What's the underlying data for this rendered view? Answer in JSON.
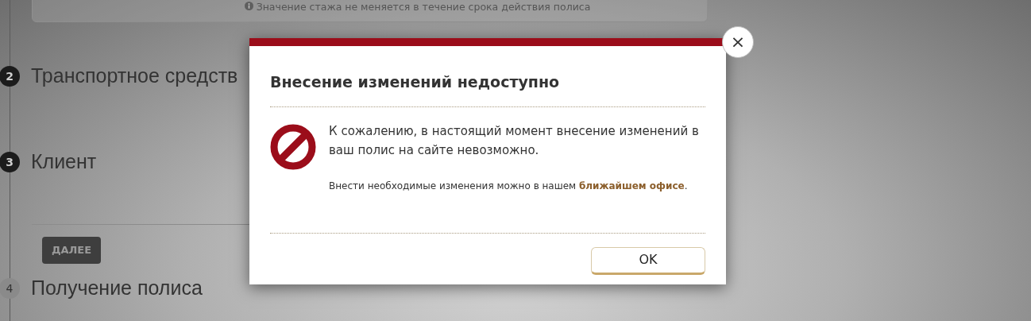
{
  "info_panel": {
    "note": "Значение стажа не меняется в течение срока действия полиса"
  },
  "steps": [
    {
      "number": "2",
      "title": "Транспортное средств",
      "active": true
    },
    {
      "number": "3",
      "title": "Клиент",
      "active": true,
      "button": "ДАЛЕЕ"
    },
    {
      "number": "4",
      "title": "Получение полиса",
      "active": false
    }
  ],
  "dialog": {
    "close": "×",
    "title": "Внесение изменений недоступно",
    "message": "К сожалению, в настоящий момент внесение изменений в ваш полис на сайте невозможно.",
    "hint": "Внести необходимые изменения можно в нашем",
    "hint_link": "ближайшем офисе",
    "hint_end": ".",
    "ok": "OK"
  }
}
